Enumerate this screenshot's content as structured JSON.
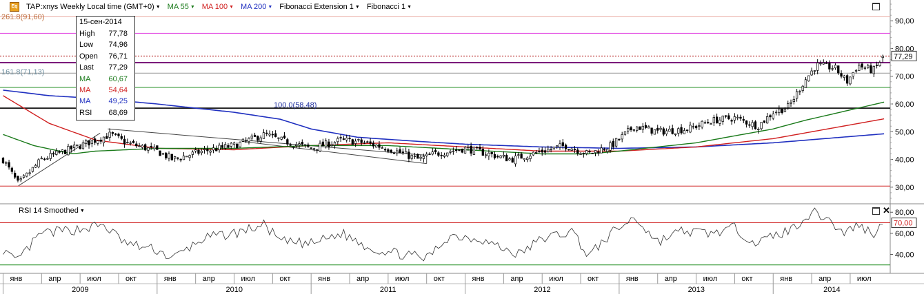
{
  "header": {
    "symbol_label": "TAP:xnys Weekly Local time (GMT+0)",
    "ma55_label": "MA 55",
    "ma100_label": "MA 100",
    "ma200_label": "MA 200",
    "fibo_ext_label": "Fibonacci Extension 1",
    "fibo_label": "Fibonacci 1",
    "logo_text": "Eq"
  },
  "fib_labels": {
    "ext_2618": "261.8(91,60)",
    "ext_1618": "161.8(71,13)",
    "ext_100": "100.0(58,48)"
  },
  "tooltip": {
    "date": "15-сен-2014",
    "rows": [
      {
        "label": "High",
        "value": "77,78",
        "color": "#000000"
      },
      {
        "label": "Low",
        "value": "74,96",
        "color": "#000000"
      },
      {
        "label": "Open",
        "value": "76,71",
        "color": "#000000"
      },
      {
        "label": "Last",
        "value": "77,29",
        "color": "#000000"
      },
      {
        "label": "MA",
        "value": "60,67",
        "color": "#1a7a1a"
      },
      {
        "label": "MA",
        "value": "54,64",
        "color": "#d02020"
      },
      {
        "label": "MA",
        "value": "49,25",
        "color": "#2030c0"
      },
      {
        "label": "RSI",
        "value": "68,69",
        "color": "#000000"
      }
    ]
  },
  "rsi_panel": {
    "title": "RSI 14 Smoothed",
    "level_label": "70,00"
  },
  "colors": {
    "ma55": "#1a7a1a",
    "ma100": "#d02020",
    "ma200": "#2030c0",
    "fib_magenta": "#e040e0",
    "fib_purple": "#7a1a7a",
    "fib_green": "#1a8a1a",
    "fib_dark": "#222222",
    "support_red": "#d02020"
  },
  "chart_data": {
    "type": "candlestick",
    "price_axis": {
      "ticks": [
        "90,00",
        "80,00",
        "70,00",
        "60,00",
        "50,00",
        "40,00",
        "30,00"
      ],
      "ylim": [
        24,
        97
      ]
    },
    "rsi_axis": {
      "ticks": [
        "80,00",
        "60,00",
        "40,00"
      ],
      "ylim": [
        22,
        88
      ]
    },
    "last_price_label": "77,29",
    "x_months": [
      "янв",
      "апр",
      "июл",
      "окт",
      "янв",
      "апр",
      "июл",
      "окт",
      "янв",
      "апр",
      "июл",
      "окт",
      "янв",
      "апр",
      "июл",
      "окт",
      "янв",
      "апр",
      "июл",
      "окт",
      "янв",
      "апр",
      "июл"
    ],
    "x_years": [
      "2009",
      "2010",
      "2011",
      "2012",
      "2013",
      "2014"
    ],
    "price_keypoints": [
      {
        "t": 2009.0,
        "v": 40
      },
      {
        "t": 2009.1,
        "v": 31
      },
      {
        "t": 2009.25,
        "v": 40
      },
      {
        "t": 2009.5,
        "v": 45
      },
      {
        "t": 2009.7,
        "v": 49
      },
      {
        "t": 2009.8,
        "v": 46
      },
      {
        "t": 2010.0,
        "v": 43
      },
      {
        "t": 2010.1,
        "v": 40
      },
      {
        "t": 2010.3,
        "v": 43
      },
      {
        "t": 2010.5,
        "v": 45
      },
      {
        "t": 2010.7,
        "v": 49
      },
      {
        "t": 2010.8,
        "v": 47
      },
      {
        "t": 2011.0,
        "v": 44
      },
      {
        "t": 2011.2,
        "v": 47
      },
      {
        "t": 2011.35,
        "v": 46
      },
      {
        "t": 2011.5,
        "v": 44
      },
      {
        "t": 2011.7,
        "v": 40
      },
      {
        "t": 2011.8,
        "v": 42
      },
      {
        "t": 2012.0,
        "v": 44
      },
      {
        "t": 2012.15,
        "v": 42
      },
      {
        "t": 2012.3,
        "v": 40
      },
      {
        "t": 2012.5,
        "v": 43
      },
      {
        "t": 2012.65,
        "v": 45
      },
      {
        "t": 2012.8,
        "v": 42
      },
      {
        "t": 2012.95,
        "v": 45
      },
      {
        "t": 2013.1,
        "v": 52
      },
      {
        "t": 2013.25,
        "v": 50
      },
      {
        "t": 2013.45,
        "v": 51
      },
      {
        "t": 2013.6,
        "v": 54
      },
      {
        "t": 2013.75,
        "v": 55
      },
      {
        "t": 2013.9,
        "v": 52
      },
      {
        "t": 2014.0,
        "v": 57
      },
      {
        "t": 2014.1,
        "v": 59
      },
      {
        "t": 2014.2,
        "v": 68
      },
      {
        "t": 2014.28,
        "v": 74
      },
      {
        "t": 2014.4,
        "v": 73
      },
      {
        "t": 2014.48,
        "v": 68
      },
      {
        "t": 2014.55,
        "v": 74
      },
      {
        "t": 2014.65,
        "v": 72
      },
      {
        "t": 2014.72,
        "v": 77.29
      }
    ],
    "ma55_keypoints": [
      {
        "t": 2009.0,
        "v": 49
      },
      {
        "t": 2009.2,
        "v": 45
      },
      {
        "t": 2009.45,
        "v": 42
      },
      {
        "t": 2009.6,
        "v": 43
      },
      {
        "t": 2010.0,
        "v": 44
      },
      {
        "t": 2010.5,
        "v": 44
      },
      {
        "t": 2011.0,
        "v": 45
      },
      {
        "t": 2011.5,
        "v": 45
      },
      {
        "t": 2012.0,
        "v": 43.5
      },
      {
        "t": 2012.5,
        "v": 42
      },
      {
        "t": 2012.8,
        "v": 42
      },
      {
        "t": 2013.0,
        "v": 43
      },
      {
        "t": 2013.5,
        "v": 46
      },
      {
        "t": 2014.0,
        "v": 51
      },
      {
        "t": 2014.2,
        "v": 54
      },
      {
        "t": 2014.72,
        "v": 60.67
      }
    ],
    "ma100_keypoints": [
      {
        "t": 2009.0,
        "v": 63
      },
      {
        "t": 2009.3,
        "v": 53
      },
      {
        "t": 2009.6,
        "v": 47
      },
      {
        "t": 2010.0,
        "v": 44
      },
      {
        "t": 2010.5,
        "v": 43.5
      },
      {
        "t": 2011.0,
        "v": 45
      },
      {
        "t": 2011.5,
        "v": 46
      },
      {
        "t": 2012.0,
        "v": 44.5
      },
      {
        "t": 2012.5,
        "v": 43
      },
      {
        "t": 2013.0,
        "v": 43
      },
      {
        "t": 2013.5,
        "v": 44.5
      },
      {
        "t": 2014.0,
        "v": 47.5
      },
      {
        "t": 2014.72,
        "v": 54.64
      }
    ],
    "ma200_keypoints": [
      {
        "t": 2009.0,
        "v": 65
      },
      {
        "t": 2009.3,
        "v": 63
      },
      {
        "t": 2009.6,
        "v": 62
      },
      {
        "t": 2010.0,
        "v": 60
      },
      {
        "t": 2010.5,
        "v": 57
      },
      {
        "t": 2010.8,
        "v": 54.5
      },
      {
        "t": 2011.0,
        "v": 51
      },
      {
        "t": 2011.3,
        "v": 48
      },
      {
        "t": 2011.7,
        "v": 46.5
      },
      {
        "t": 2012.0,
        "v": 45.5
      },
      {
        "t": 2012.5,
        "v": 44.5
      },
      {
        "t": 2013.0,
        "v": 44
      },
      {
        "t": 2013.5,
        "v": 44.5
      },
      {
        "t": 2014.0,
        "v": 46
      },
      {
        "t": 2014.72,
        "v": 49.25
      }
    ],
    "rsi_keypoints": [
      {
        "t": 2009.0,
        "v": 45
      },
      {
        "t": 2009.08,
        "v": 32
      },
      {
        "t": 2009.25,
        "v": 60
      },
      {
        "t": 2009.5,
        "v": 64
      },
      {
        "t": 2009.65,
        "v": 68
      },
      {
        "t": 2009.8,
        "v": 50
      },
      {
        "t": 2010.0,
        "v": 44
      },
      {
        "t": 2010.1,
        "v": 36
      },
      {
        "t": 2010.3,
        "v": 55
      },
      {
        "t": 2010.5,
        "v": 60
      },
      {
        "t": 2010.7,
        "v": 68
      },
      {
        "t": 2010.8,
        "v": 52
      },
      {
        "t": 2011.0,
        "v": 50
      },
      {
        "t": 2011.2,
        "v": 60
      },
      {
        "t": 2011.4,
        "v": 45
      },
      {
        "t": 2011.6,
        "v": 40
      },
      {
        "t": 2011.75,
        "v": 36
      },
      {
        "t": 2011.9,
        "v": 58
      },
      {
        "t": 2012.1,
        "v": 55
      },
      {
        "t": 2012.25,
        "v": 45
      },
      {
        "t": 2012.35,
        "v": 40
      },
      {
        "t": 2012.5,
        "v": 55
      },
      {
        "t": 2012.7,
        "v": 62
      },
      {
        "t": 2012.8,
        "v": 38
      },
      {
        "t": 2012.95,
        "v": 60
      },
      {
        "t": 2013.1,
        "v": 75
      },
      {
        "t": 2013.25,
        "v": 52
      },
      {
        "t": 2013.4,
        "v": 62
      },
      {
        "t": 2013.6,
        "v": 60
      },
      {
        "t": 2013.75,
        "v": 65
      },
      {
        "t": 2013.9,
        "v": 50
      },
      {
        "t": 2014.0,
        "v": 58
      },
      {
        "t": 2014.1,
        "v": 62
      },
      {
        "t": 2014.25,
        "v": 80
      },
      {
        "t": 2014.35,
        "v": 75
      },
      {
        "t": 2014.45,
        "v": 60
      },
      {
        "t": 2014.55,
        "v": 68
      },
      {
        "t": 2014.65,
        "v": 60
      },
      {
        "t": 2014.72,
        "v": 68.69
      }
    ],
    "fib_levels": [
      {
        "v": 91.6,
        "color": "#e8a8a0",
        "style": "thin"
      },
      {
        "v": 85.5,
        "color": "#e040e0",
        "style": "solid"
      },
      {
        "v": 77.29,
        "color": "#b01010",
        "style": "dotted"
      },
      {
        "v": 74.9,
        "color": "#7a1a7a",
        "style": "thick"
      },
      {
        "v": 71.13,
        "color": "#999999",
        "style": "thin"
      },
      {
        "v": 66.0,
        "color": "#1a8a1a",
        "style": "solid"
      },
      {
        "v": 58.48,
        "color": "#222222",
        "style": "thick"
      },
      {
        "v": 30.4,
        "color": "#d02020",
        "style": "solid"
      }
    ],
    "rsi_levels": [
      70,
      30
    ]
  }
}
